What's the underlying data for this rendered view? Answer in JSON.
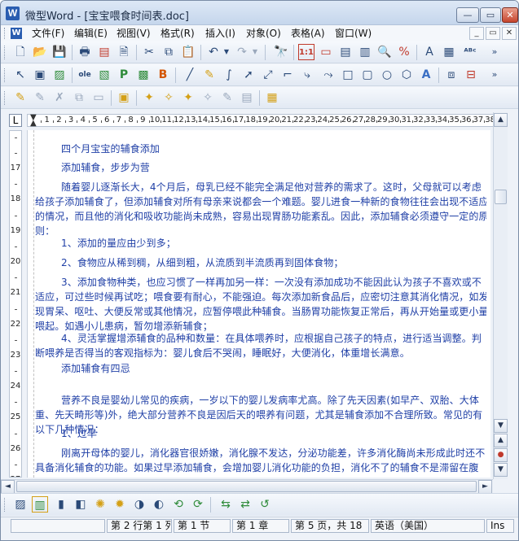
{
  "window": {
    "title": "微型Word - [宝宝喂食时间表.doc]",
    "app_icon": "W",
    "minimize": "—",
    "maximize": "▭",
    "close": "✕"
  },
  "menu": {
    "items": [
      "文件(F)",
      "编辑(E)",
      "视图(V)",
      "格式(R)",
      "插入(I)",
      "对象(O)",
      "表格(A)",
      "窗口(W)"
    ],
    "mdi": [
      "_",
      "▭",
      "✕"
    ]
  },
  "toolbars": {
    "row1_icons": [
      "new-icon",
      "open-icon",
      "save-icon",
      "print-icon",
      "pdf-icon",
      "print-preview-icon",
      "cut-icon",
      "copy-icon",
      "paste-icon",
      "undo-icon",
      "redo-icon",
      "find-icon",
      "page-view-icon",
      "zoom-icon",
      "replace-icon",
      "text-box-icon",
      "spellcheck-icon"
    ],
    "row2_icons": [
      "select-icon",
      "frame-icon",
      "image-icon",
      "ole-icon",
      "field-icon",
      "insert-icon",
      "line-icon",
      "pen-icon",
      "curve-icon",
      "arrow-icon",
      "connector-icon",
      "elbow-connector-icon",
      "rectangle-icon",
      "ellipse-icon",
      "shape-icon",
      "wordart-icon",
      "group-icon",
      "align-icon"
    ],
    "row3_icons": [
      "edit-icon",
      "edit2-icon",
      "delete-icon",
      "copy2-icon",
      "paste2-icon",
      "wand-icon",
      "wand2-icon",
      "wand3-icon",
      "wand4-icon",
      "format-icon",
      "properties-icon"
    ]
  },
  "ruler": {
    "corner": "L",
    "numbers": [
      "1",
      "2",
      "3",
      "4",
      "5",
      "6",
      "7",
      "8",
      "9",
      "10",
      "11",
      "12",
      "13",
      "14",
      "15",
      "16",
      "17",
      "18",
      "19",
      "20",
      "21",
      "22",
      "23",
      "24",
      "25",
      "26",
      "27",
      "28",
      "29",
      "30",
      "31",
      "32",
      "33",
      "34",
      "35",
      "36",
      "37",
      "38"
    ],
    "vnumbers": [
      "17",
      "18",
      "19",
      "20",
      "21",
      "22",
      "23",
      "24",
      "25",
      "26",
      "27"
    ]
  },
  "document": {
    "paragraphs": [
      {
        "lines": [
          "四个月宝宝的辅食添加"
        ]
      },
      {
        "lines": [
          "添加辅食，步步为营"
        ]
      },
      {
        "lines": [
          "随着婴儿逐渐长大，4个月后，母乳已经不能完全满足他对营养的需求了。这时，父母就可以考虑",
          "给孩子添加辅食了，但添加辅食对所有母亲来说都会一个难题。婴儿进食一种新的食物往往会出现不适应",
          "的情况，而且他的消化和吸收功能尚未成熟，容易出现胃肠功能紊乱。因此，添加辅食必须遵守一定的原",
          "则："
        ]
      },
      {
        "lines": [
          "1、添加的量应由少到多；"
        ]
      },
      {
        "lines": [
          "2、食物应从稀到稠，从细到粗，从流质到半流质再到固体食物；"
        ]
      },
      {
        "lines": [
          "3、添加食物种类，也应习惯了一样再加另一样：一次没有添加成功不能因此认为孩子不喜欢或不",
          "适应，可过些时候再试吃；喂食要有耐心，不能强迫。每次添加新食品后，应密切注意其消化情况，如发",
          "现胃呆、呕吐、大便反常或其他情况，应暂停喂此种辅食。当肠胃功能恢复正常后，再从开始量或更小量",
          "喂起。如遇小儿患病，暂勿增添新辅食；"
        ]
      },
      {
        "lines": [
          "4、灵活掌握增添辅食的品种和数量：在具体喂养时，应根据自己孩子的特点，进行适当调整。判",
          "断喂养是否得当的客观指标为：婴儿食后不哭闹，睡眠好，大便消化，体重增长满意。"
        ]
      },
      {
        "lines": [
          "添加辅食有四忌"
        ]
      },
      {
        "lines": [
          "营养不良是婴幼儿常见的疾病，一岁以下的婴儿发病率尤高。除了先天因素(如早产、双胎、大体",
          "重、先天畸形等)外，绝大部分营养不良是因后天的喂养有问题，尤其是辅食添加不合理所致。常见的有",
          "以下几种情况："
        ]
      },
      {
        "lines": [
          "1、过早"
        ]
      },
      {
        "lines": [
          "刚离开母体的婴儿，消化器官很娇嫩，消化腺不发达，分泌功能差，许多消化酶尚未形成此时还不",
          "具备消化辅食的功能。如果过早添加辅食，会增加婴儿消化功能的负担，消化不了的辅食不是滞留在腹"
        ]
      }
    ]
  },
  "scrollbar": {
    "up": "▲",
    "down": "▼",
    "prev_page": "▲",
    "browse": "●",
    "next_page": "▼",
    "left": "◄",
    "right": "►"
  },
  "drawbar_icons": [
    "tool1-icon",
    "tool2-icon",
    "gradient-icon",
    "contrast-icon",
    "brightness-up-icon",
    "brightness-down-icon",
    "contrast-up-icon",
    "contrast-down-icon",
    "rotate-left-icon",
    "rotate-right-icon",
    "flip-icon",
    "recolor-icon",
    "reset-icon"
  ],
  "status": {
    "position": "第 2 行第 1 列",
    "section": "第 1 节",
    "chapter": "第 1 章",
    "page": "第 5 页，共 18",
    "language": "英语（美国）",
    "mode": "Ins"
  }
}
